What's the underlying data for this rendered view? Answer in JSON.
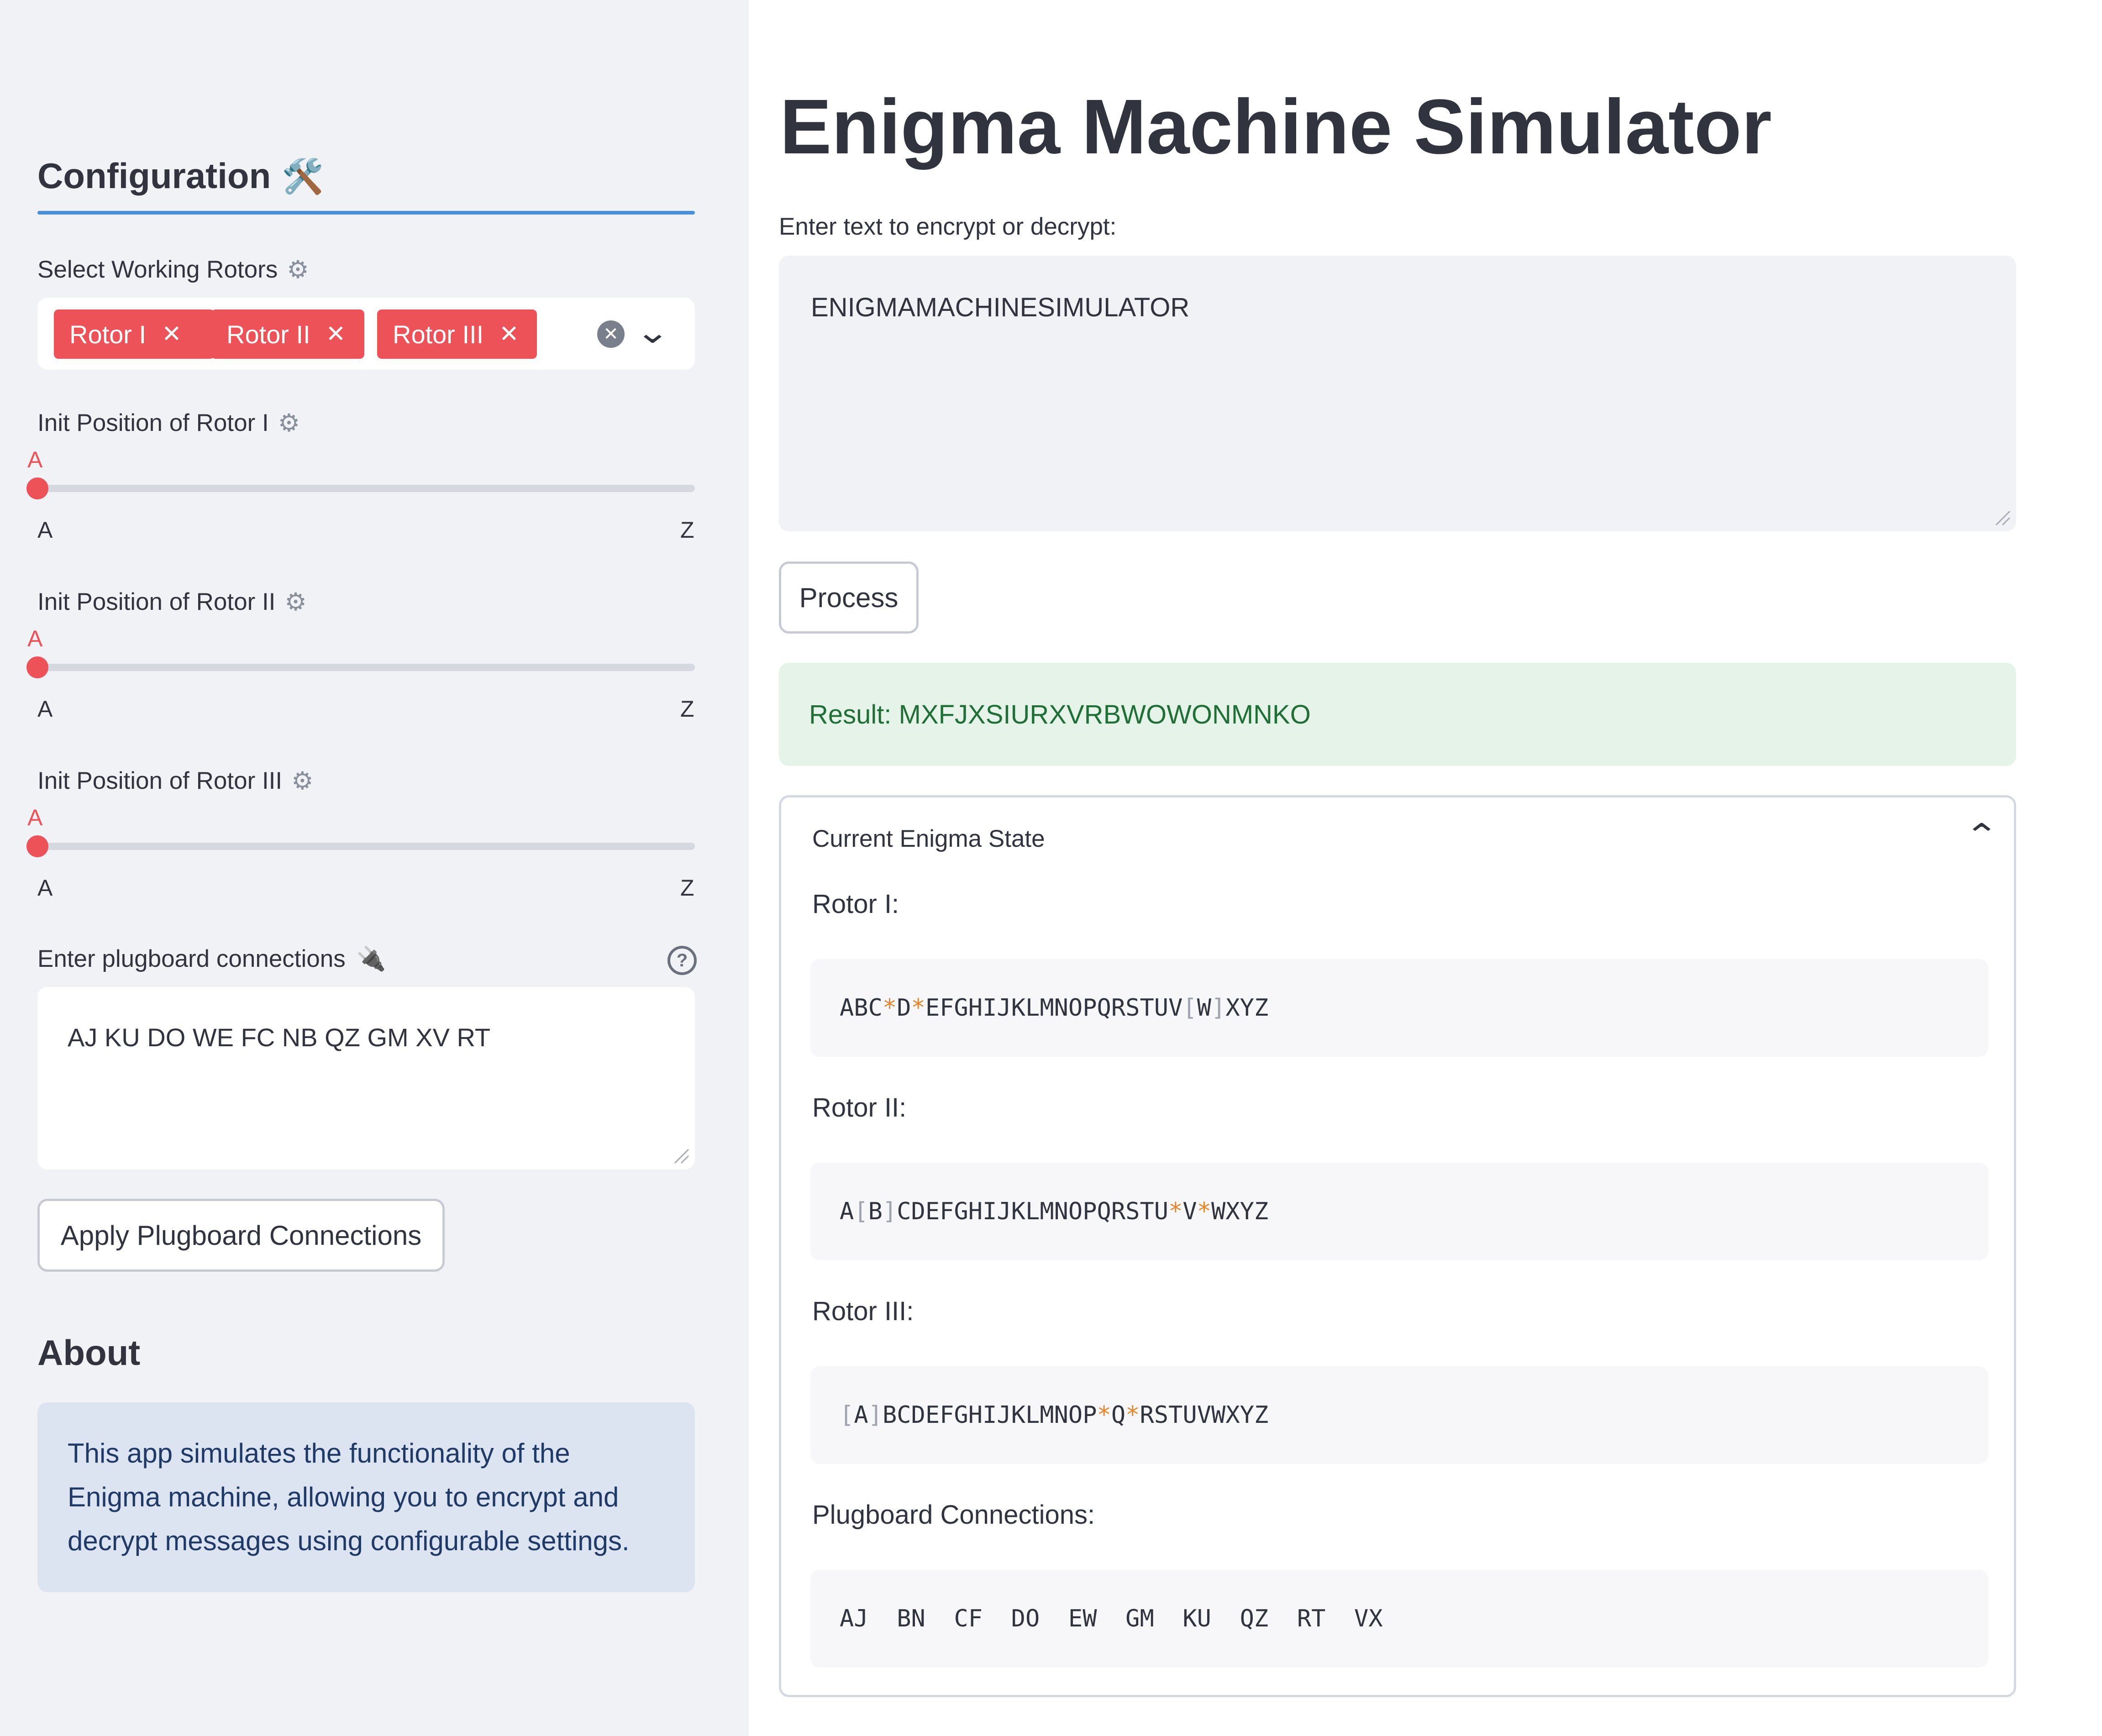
{
  "sidebar": {
    "config_title": "Configuration",
    "config_icon": "🛠️",
    "rotors_label": "Select Working Rotors",
    "rotor_chips": [
      "Rotor I",
      "Rotor II",
      "Rotor III"
    ],
    "chip_remove": "✕",
    "sliders": [
      {
        "label": "Init Position of Rotor I",
        "value": "A",
        "min": "A",
        "max": "Z",
        "fraction": 0
      },
      {
        "label": "Init Position of Rotor II",
        "value": "A",
        "min": "A",
        "max": "Z",
        "fraction": 0
      },
      {
        "label": "Init Position of Rotor III",
        "value": "A",
        "min": "A",
        "max": "Z",
        "fraction": 0
      }
    ],
    "plug_label": "Enter plugboard connections",
    "plug_icon": "🔌",
    "plug_help": "?",
    "plug_value": "AJ KU DO WE FC NB QZ GM XV RT",
    "apply_button": "Apply Plugboard Connections",
    "about_title": "About",
    "about_text": "This app simulates the functionality of the Enigma machine, allowing you to encrypt and decrypt messages using configurable settings."
  },
  "main": {
    "title": "Enigma Machine Simulator",
    "input_label": "Enter text to encrypt or decrypt:",
    "input_value": "ENIGMAMACHINESIMULATOR",
    "process_button": "Process",
    "result": "Result: MXFJXSIURXVRBWOWONMNKO",
    "expander_title": "Current Enigma State",
    "rotor1_label": "Rotor I:",
    "rotor2_label": "Rotor II:",
    "rotor3_label": "Rotor III:",
    "plug_state_label": "Plugboard Connections:",
    "plug_state": "AJ  BN  CF  DO  EW  GM  KU  QZ  RT  VX"
  },
  "rotor_states": [
    [
      {
        "t": "ABC"
      },
      {
        "t": "*",
        "c": "star"
      },
      {
        "t": "D"
      },
      {
        "t": "*",
        "c": "star"
      },
      {
        "t": "EFGHIJKLMNOPQRSTUV"
      },
      {
        "t": "[",
        "c": "brk"
      },
      {
        "t": "W"
      },
      {
        "t": "]",
        "c": "brk"
      },
      {
        "t": "XYZ"
      }
    ],
    [
      {
        "t": "A"
      },
      {
        "t": "[",
        "c": "brk"
      },
      {
        "t": "B"
      },
      {
        "t": "]",
        "c": "brk"
      },
      {
        "t": "CDEFGHIJKLMNOPQRSTU"
      },
      {
        "t": "*",
        "c": "star"
      },
      {
        "t": "V"
      },
      {
        "t": "*",
        "c": "star"
      },
      {
        "t": "WXYZ"
      }
    ],
    [
      {
        "t": "[",
        "c": "brk"
      },
      {
        "t": "A"
      },
      {
        "t": "]",
        "c": "brk"
      },
      {
        "t": "BCDEFGHIJKLMNOP"
      },
      {
        "t": "*",
        "c": "star"
      },
      {
        "t": "Q"
      },
      {
        "t": "*",
        "c": "star"
      },
      {
        "t": "RSTUVWXYZ"
      }
    ]
  ],
  "colors": {
    "accent": "#ee5259",
    "result_bg": "#e6f3e9",
    "result_text": "#1f6f36",
    "about_bg": "#dce4f1"
  }
}
